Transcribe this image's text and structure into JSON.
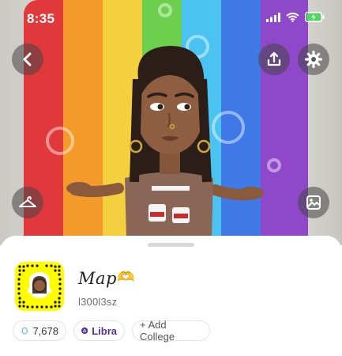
{
  "status_bar": {
    "time": "8:35"
  },
  "hero": {
    "back_icon": "chevron-left-icon",
    "share_icon": "share-icon",
    "settings_icon": "gear-icon",
    "outfit_icon": "hanger-icon",
    "background_icon": "image-icon",
    "band_colors": [
      "#e1383b",
      "#f39a2a",
      "#f4d03f",
      "#6ccf4e",
      "#4bc3f0",
      "#3f79e6",
      "#8e48c9"
    ]
  },
  "profile": {
    "display_name": "Map",
    "name_emoji": "🫶",
    "username": "l300l3sz",
    "snapcode_icon": "snapcode-icon"
  },
  "chips": {
    "score": {
      "icon": "snap-score-icon",
      "value": "7,678"
    },
    "zodiac": {
      "icon": "libra-icon",
      "label": "Libra",
      "color": "#5a2fa0"
    },
    "college": {
      "label": "+ Add College"
    }
  }
}
